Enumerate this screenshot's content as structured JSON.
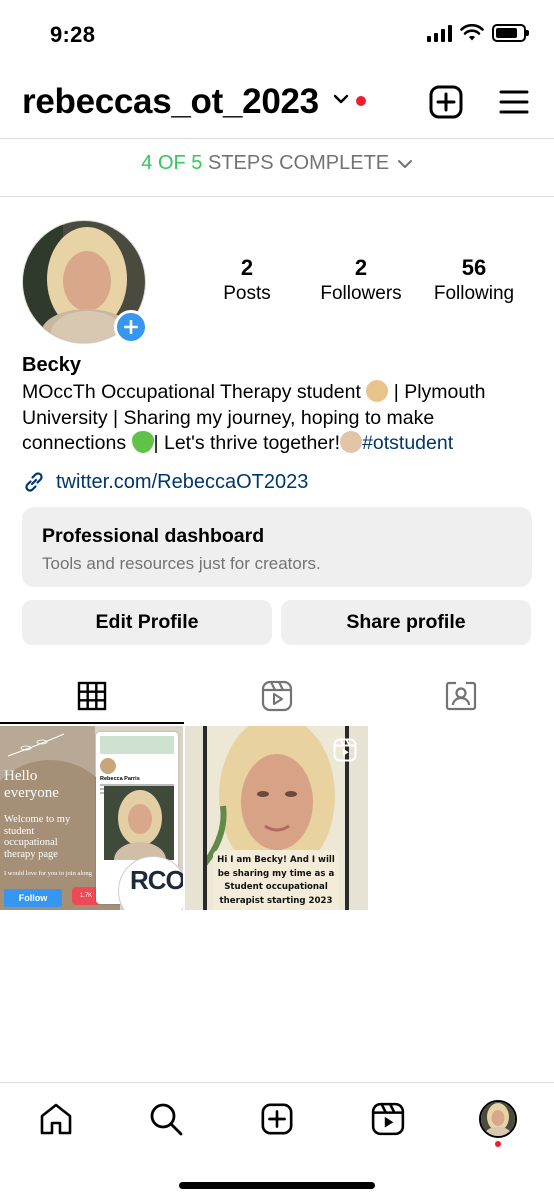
{
  "status_bar": {
    "time": "9:28"
  },
  "header": {
    "username": "rebeccas_ot_2023",
    "icons": {
      "chevron": "chevron-down-icon",
      "create": "plus-square-icon",
      "menu": "hamburger-menu-icon"
    },
    "notification_dot_color": "#ed1f2f"
  },
  "steps": {
    "done": "4 OF 5",
    "rest": " STEPS COMPLETE",
    "done_color": "#34c759"
  },
  "profile": {
    "stats": {
      "posts": {
        "count": "2",
        "label": "Posts"
      },
      "followers": {
        "count": "2",
        "label": "Followers"
      },
      "following": {
        "count": "56",
        "label": "Following"
      }
    },
    "name": "Becky",
    "bio": {
      "part1": "MOccTh Occupational Therapy student ",
      "part2": " | Plymouth University | Sharing my journey, hoping to make connections ",
      "part3": "| Let's thrive together!",
      "hashtag": "#otstudent"
    },
    "link": "twitter.com/RebeccaOT2023"
  },
  "dashboard": {
    "title": "Professional dashboard",
    "subtitle": "Tools and resources just for creators."
  },
  "buttons": {
    "edit": "Edit Profile",
    "share": "Share profile"
  },
  "tabs": [
    {
      "name": "grid",
      "icon": "grid-icon"
    },
    {
      "name": "reels",
      "icon": "reels-icon"
    },
    {
      "name": "tagged",
      "icon": "tagged-person-icon"
    }
  ],
  "posts": [
    {
      "hello": "Hello everyone",
      "welcome": "Welcome to my student occupational therapy page",
      "love": "I would love for you to join along",
      "follow": "Follow",
      "likes": "1.7K",
      "card_name": "Rebecca Parris",
      "logo": "RCOT"
    },
    {
      "caption": "Hi I am Becky! And I will be sharing my time as a Student occupational therapist starting 2023",
      "icon": "reel-icon"
    }
  ],
  "bottom_nav": [
    {
      "name": "home",
      "icon": "home-icon"
    },
    {
      "name": "search",
      "icon": "search-icon"
    },
    {
      "name": "create",
      "icon": "plus-square-icon"
    },
    {
      "name": "reels",
      "icon": "reels-icon"
    },
    {
      "name": "profile",
      "icon": "avatar"
    }
  ],
  "colors": {
    "link": "#00376b",
    "accent_blue": "#3797f0",
    "button_bg": "#efefef",
    "muted": "#737373"
  }
}
